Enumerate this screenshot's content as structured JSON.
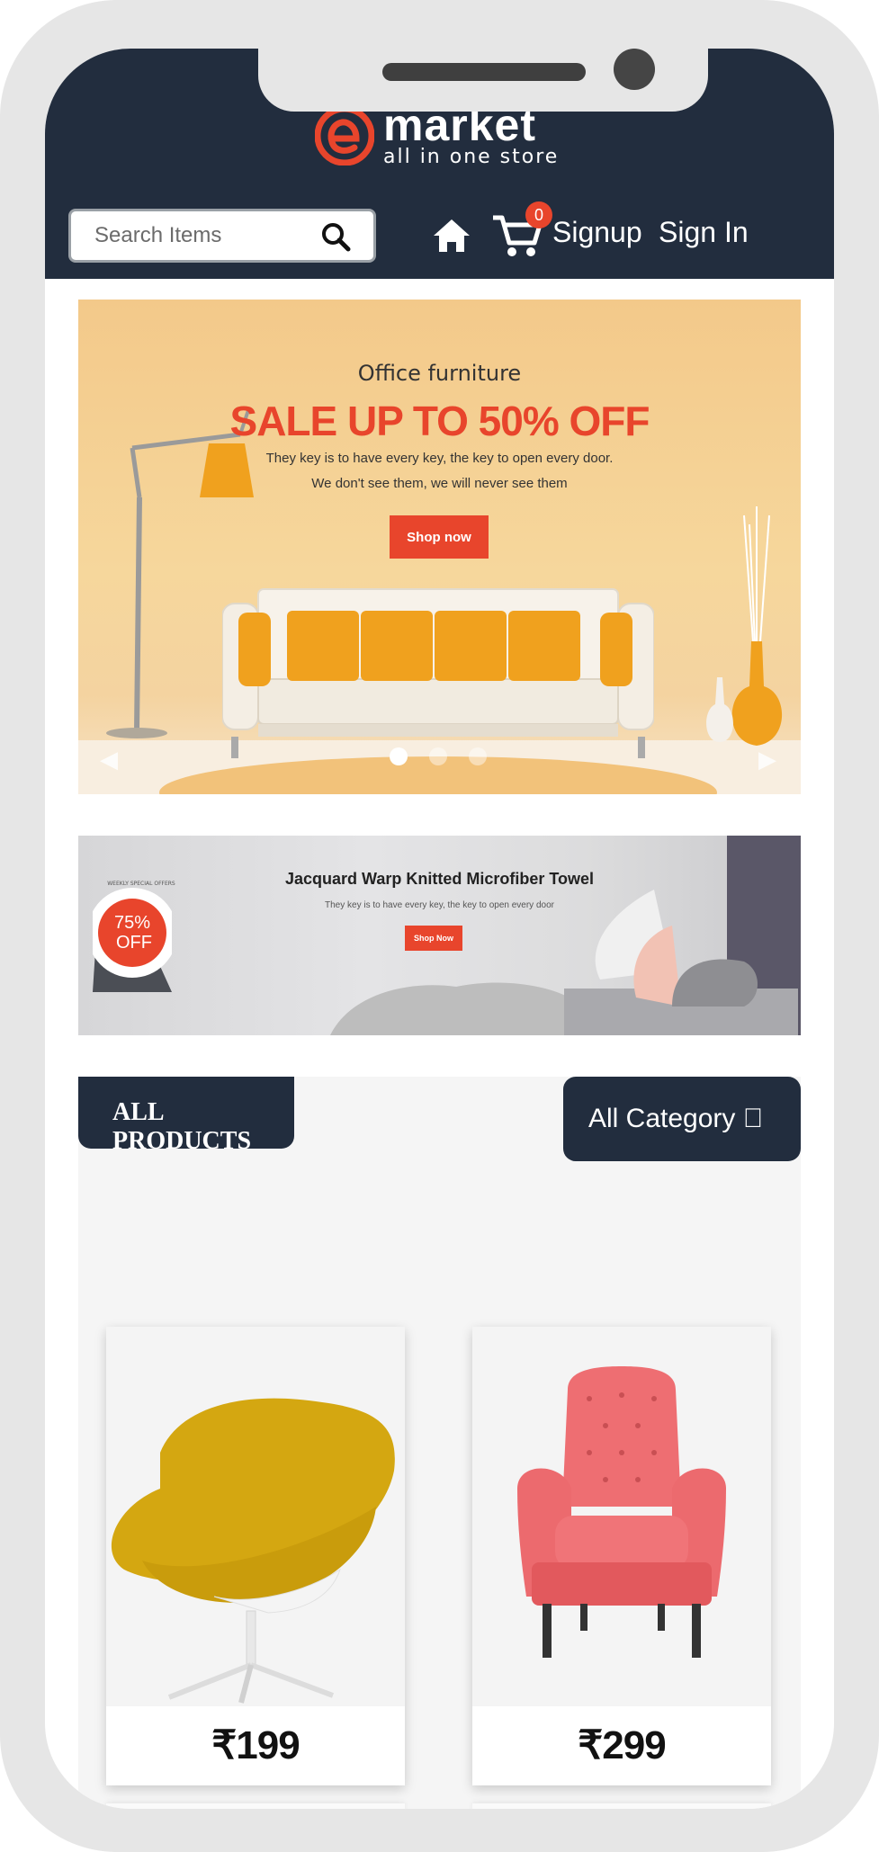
{
  "header": {
    "logo_word": "market",
    "logo_tagline": "all in one store",
    "search": {
      "placeholder": "Search Items",
      "value": ""
    },
    "cart_count": "0",
    "signup_label": "Signup",
    "signin_label": "Sign In"
  },
  "hero": {
    "kicker": "Office furniture",
    "title": "SALE UP TO 50% OFF",
    "line1": "They key is to have every key, the key to open every door.",
    "line2": "We don't see them, we will never see them",
    "button_label": "Shop now",
    "slide_count": 3,
    "active_slide": 1
  },
  "banner2": {
    "title": "Jacquard Warp Knitted Microfiber Towel",
    "subtitle": "They key is to have every key, the key to open every door",
    "button_label": "Shop Now",
    "seal_percent": "75%",
    "seal_off": "OFF",
    "seal_ring": "WEEKLY SPECIAL OFFERS"
  },
  "products": {
    "heading": "ALL PRODUCTS",
    "category_label": "All Category ",
    "items": [
      {
        "name": "yellow-lounge-chair",
        "price": "₹199"
      },
      {
        "name": "pink-armchair",
        "price": "₹299"
      }
    ]
  },
  "colors": {
    "header_bg": "#222d3e",
    "accent": "#e8452c",
    "section_bg": "#f5f5f5"
  }
}
